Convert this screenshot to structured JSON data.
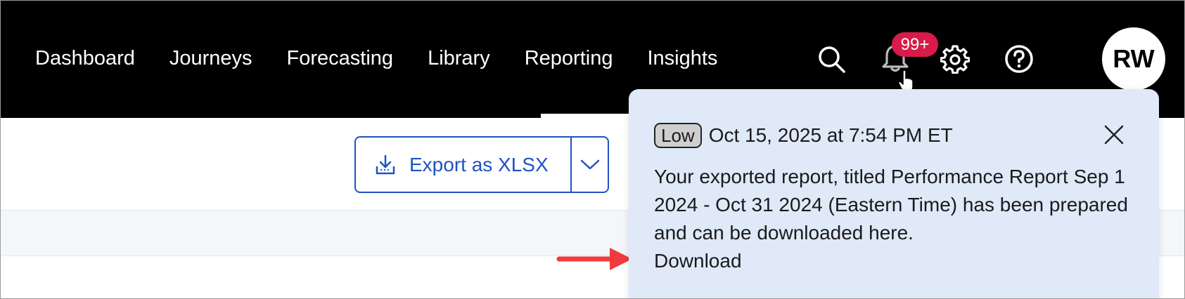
{
  "nav": {
    "items": [
      {
        "label": "Dashboard"
      },
      {
        "label": "Journeys"
      },
      {
        "label": "Forecasting"
      },
      {
        "label": "Library"
      },
      {
        "label": "Reporting"
      },
      {
        "label": "Insights"
      }
    ],
    "active": "Reporting"
  },
  "header": {
    "notification_badge": "99+",
    "avatar_initials": "RW",
    "icons": [
      "search-icon",
      "bell-icon",
      "gear-icon",
      "help-icon"
    ]
  },
  "toolbar": {
    "export_label": "Export as XLSX",
    "export_icon": "download-tray-icon"
  },
  "notification": {
    "priority": "Low",
    "timestamp": "Oct 15, 2025 at 7:54 PM ET",
    "message": "Your exported report, titled Performance Report Sep 1 2024 - Oct 31 2024 (Eastern Time) has been prepared and can be downloaded here.",
    "link_label": "Download"
  },
  "colors": {
    "topbar": "#000000",
    "accent": "#1f52c4",
    "badge": "#d81b4a",
    "popover_bg": "#dfe9f8",
    "annotation_arrow": "#ef3b3b"
  }
}
